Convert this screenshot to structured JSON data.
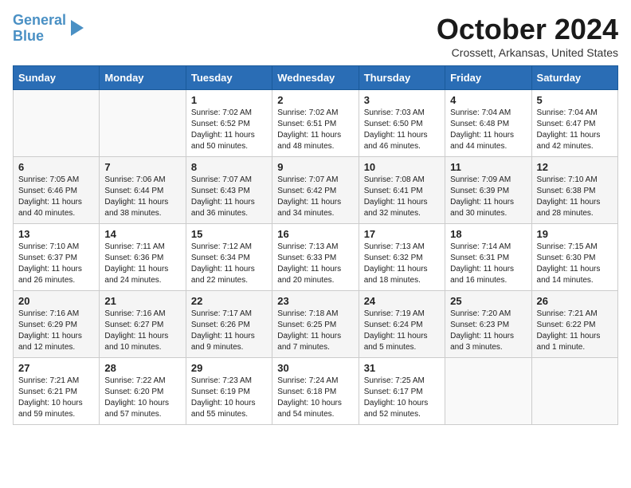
{
  "logo": {
    "line1": "General",
    "line2": "Blue"
  },
  "title": "October 2024",
  "location": "Crossett, Arkansas, United States",
  "days_of_week": [
    "Sunday",
    "Monday",
    "Tuesday",
    "Wednesday",
    "Thursday",
    "Friday",
    "Saturday"
  ],
  "weeks": [
    [
      {
        "day": "",
        "info": ""
      },
      {
        "day": "",
        "info": ""
      },
      {
        "day": "1",
        "info": "Sunrise: 7:02 AM\nSunset: 6:52 PM\nDaylight: 11 hours and 50 minutes."
      },
      {
        "day": "2",
        "info": "Sunrise: 7:02 AM\nSunset: 6:51 PM\nDaylight: 11 hours and 48 minutes."
      },
      {
        "day": "3",
        "info": "Sunrise: 7:03 AM\nSunset: 6:50 PM\nDaylight: 11 hours and 46 minutes."
      },
      {
        "day": "4",
        "info": "Sunrise: 7:04 AM\nSunset: 6:48 PM\nDaylight: 11 hours and 44 minutes."
      },
      {
        "day": "5",
        "info": "Sunrise: 7:04 AM\nSunset: 6:47 PM\nDaylight: 11 hours and 42 minutes."
      }
    ],
    [
      {
        "day": "6",
        "info": "Sunrise: 7:05 AM\nSunset: 6:46 PM\nDaylight: 11 hours and 40 minutes."
      },
      {
        "day": "7",
        "info": "Sunrise: 7:06 AM\nSunset: 6:44 PM\nDaylight: 11 hours and 38 minutes."
      },
      {
        "day": "8",
        "info": "Sunrise: 7:07 AM\nSunset: 6:43 PM\nDaylight: 11 hours and 36 minutes."
      },
      {
        "day": "9",
        "info": "Sunrise: 7:07 AM\nSunset: 6:42 PM\nDaylight: 11 hours and 34 minutes."
      },
      {
        "day": "10",
        "info": "Sunrise: 7:08 AM\nSunset: 6:41 PM\nDaylight: 11 hours and 32 minutes."
      },
      {
        "day": "11",
        "info": "Sunrise: 7:09 AM\nSunset: 6:39 PM\nDaylight: 11 hours and 30 minutes."
      },
      {
        "day": "12",
        "info": "Sunrise: 7:10 AM\nSunset: 6:38 PM\nDaylight: 11 hours and 28 minutes."
      }
    ],
    [
      {
        "day": "13",
        "info": "Sunrise: 7:10 AM\nSunset: 6:37 PM\nDaylight: 11 hours and 26 minutes."
      },
      {
        "day": "14",
        "info": "Sunrise: 7:11 AM\nSunset: 6:36 PM\nDaylight: 11 hours and 24 minutes."
      },
      {
        "day": "15",
        "info": "Sunrise: 7:12 AM\nSunset: 6:34 PM\nDaylight: 11 hours and 22 minutes."
      },
      {
        "day": "16",
        "info": "Sunrise: 7:13 AM\nSunset: 6:33 PM\nDaylight: 11 hours and 20 minutes."
      },
      {
        "day": "17",
        "info": "Sunrise: 7:13 AM\nSunset: 6:32 PM\nDaylight: 11 hours and 18 minutes."
      },
      {
        "day": "18",
        "info": "Sunrise: 7:14 AM\nSunset: 6:31 PM\nDaylight: 11 hours and 16 minutes."
      },
      {
        "day": "19",
        "info": "Sunrise: 7:15 AM\nSunset: 6:30 PM\nDaylight: 11 hours and 14 minutes."
      }
    ],
    [
      {
        "day": "20",
        "info": "Sunrise: 7:16 AM\nSunset: 6:29 PM\nDaylight: 11 hours and 12 minutes."
      },
      {
        "day": "21",
        "info": "Sunrise: 7:16 AM\nSunset: 6:27 PM\nDaylight: 11 hours and 10 minutes."
      },
      {
        "day": "22",
        "info": "Sunrise: 7:17 AM\nSunset: 6:26 PM\nDaylight: 11 hours and 9 minutes."
      },
      {
        "day": "23",
        "info": "Sunrise: 7:18 AM\nSunset: 6:25 PM\nDaylight: 11 hours and 7 minutes."
      },
      {
        "day": "24",
        "info": "Sunrise: 7:19 AM\nSunset: 6:24 PM\nDaylight: 11 hours and 5 minutes."
      },
      {
        "day": "25",
        "info": "Sunrise: 7:20 AM\nSunset: 6:23 PM\nDaylight: 11 hours and 3 minutes."
      },
      {
        "day": "26",
        "info": "Sunrise: 7:21 AM\nSunset: 6:22 PM\nDaylight: 11 hours and 1 minute."
      }
    ],
    [
      {
        "day": "27",
        "info": "Sunrise: 7:21 AM\nSunset: 6:21 PM\nDaylight: 10 hours and 59 minutes."
      },
      {
        "day": "28",
        "info": "Sunrise: 7:22 AM\nSunset: 6:20 PM\nDaylight: 10 hours and 57 minutes."
      },
      {
        "day": "29",
        "info": "Sunrise: 7:23 AM\nSunset: 6:19 PM\nDaylight: 10 hours and 55 minutes."
      },
      {
        "day": "30",
        "info": "Sunrise: 7:24 AM\nSunset: 6:18 PM\nDaylight: 10 hours and 54 minutes."
      },
      {
        "day": "31",
        "info": "Sunrise: 7:25 AM\nSunset: 6:17 PM\nDaylight: 10 hours and 52 minutes."
      },
      {
        "day": "",
        "info": ""
      },
      {
        "day": "",
        "info": ""
      }
    ]
  ]
}
